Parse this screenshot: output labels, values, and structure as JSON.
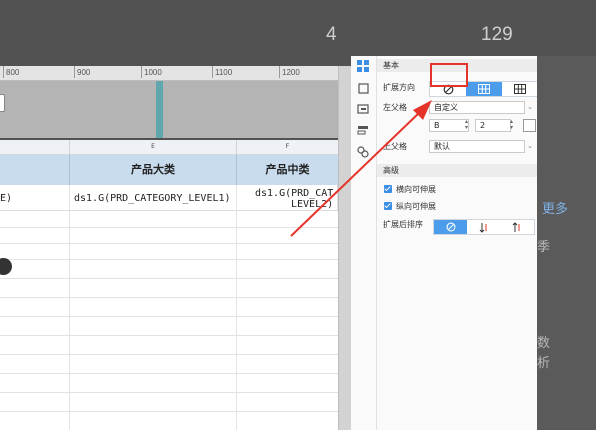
{
  "background": {
    "num_left": "4",
    "num_right": "129",
    "side_link": "更多",
    "side_char1": "季",
    "side_char2": "数",
    "side_char3": "析"
  },
  "ruler": {
    "ticks": [
      "800",
      "900",
      "1000",
      "1100",
      "1200"
    ]
  },
  "sheet": {
    "col_letters": [
      "E",
      "F"
    ],
    "headers": [
      "产品大类",
      "产品中类"
    ],
    "row1": [
      "E)",
      "ds1.G(PRD_CATEGORY_LEVEL1)",
      "ds1.G(PRD_CAT",
      "LEVEL2)"
    ]
  },
  "panel": {
    "section_basic": "基本",
    "expand_dir_label": "扩展方向",
    "left_parent_label": "左父格",
    "left_parent_value": "自定义",
    "coord_col": "B",
    "coord_row": "2",
    "top_parent_label": "上父格",
    "top_parent_value": "默认",
    "section_advanced": "高级",
    "chk_h": "横向可伸展",
    "chk_v": "纵向可伸展",
    "sort_label": "扩展后排序"
  },
  "colors": {
    "accent": "#4b9dec",
    "header_fill": "#c8dcee",
    "annotation_red": "#e5332a"
  },
  "icons": [
    "prohibit-icon",
    "grid-icon",
    "table-icon",
    "chevron-down-icon",
    "sort-asc-icon",
    "sort-desc-icon",
    "cell-element-icon",
    "style-icon",
    "link-icon",
    "condition-icon",
    "hyperlink-icon"
  ]
}
